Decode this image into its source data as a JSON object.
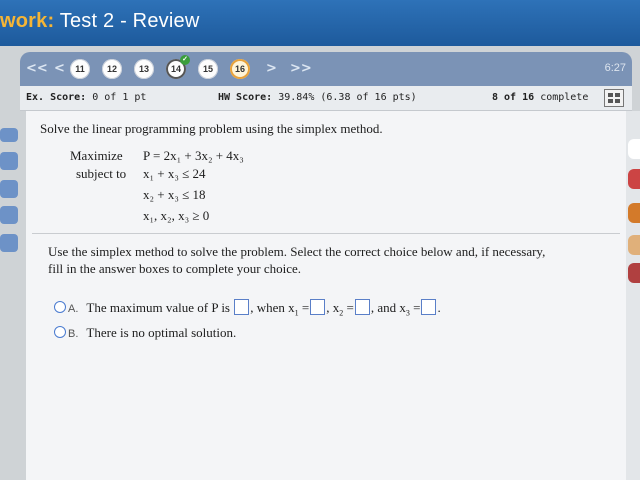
{
  "window": {
    "title_prefix": "work:",
    "title": "Test 2 - Review"
  },
  "nav": {
    "first": "<<",
    "prev": "<",
    "next": ">",
    "last": ">>",
    "questions": [
      "11",
      "12",
      "13",
      "14",
      "15",
      "16"
    ],
    "current": "16",
    "answered": "14",
    "timer": "6:27"
  },
  "status": {
    "ex_label": "Ex. Score:",
    "ex_value": "0 of 1 pt",
    "hw_label": "HW Score:",
    "hw_value": "39.84% (6.38 of 16 pts)",
    "progress": "8 of 16",
    "progress_suffix": "complete"
  },
  "question": {
    "prompt": "Solve the linear programming problem using the simplex method.",
    "maximize": "Maximize",
    "subject_to": "subject to",
    "objective": "P = 2x₁ + 3x₂ + 4x₃",
    "constraints": [
      "x₁ + x₃ ≤ 24",
      "x₂ + x₃ ≤ 18",
      "x₁, x₂, x₃ ≥ 0"
    ]
  },
  "instructions": {
    "line1": "Use the simplex method to solve the problem. Select the correct choice below and, if necessary,",
    "line2": "fill in the answer boxes to complete your choice."
  },
  "options": {
    "a_letter": "A.",
    "a_text1": "The maximum value of P is",
    "a_text2": ", when x",
    "a_text3": ", x",
    "a_text4": ", and x",
    "b_letter": "B.",
    "b_text": "There is no optimal solution."
  },
  "colors": {
    "title_bg": "#1d5a9c",
    "title_prefix": "#f5b536",
    "nav_bg": "#7b93b6",
    "panel_bg": "#f4f5f7"
  }
}
